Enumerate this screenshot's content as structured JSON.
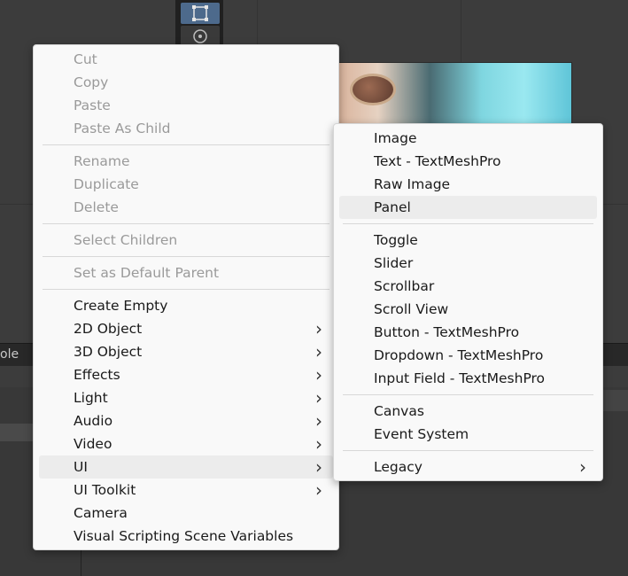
{
  "background": {
    "panel_tab_label": "ole"
  },
  "context_menu": {
    "groups": [
      [
        {
          "label": "Cut",
          "enabled": false
        },
        {
          "label": "Copy",
          "enabled": false
        },
        {
          "label": "Paste",
          "enabled": false
        },
        {
          "label": "Paste As Child",
          "enabled": false
        }
      ],
      [
        {
          "label": "Rename",
          "enabled": false
        },
        {
          "label": "Duplicate",
          "enabled": false
        },
        {
          "label": "Delete",
          "enabled": false
        }
      ],
      [
        {
          "label": "Select Children",
          "enabled": false
        }
      ],
      [
        {
          "label": "Set as Default Parent",
          "enabled": false
        }
      ],
      [
        {
          "label": "Create Empty",
          "enabled": true
        },
        {
          "label": "2D Object",
          "enabled": true,
          "submenu": true
        },
        {
          "label": "3D Object",
          "enabled": true,
          "submenu": true
        },
        {
          "label": "Effects",
          "enabled": true,
          "submenu": true
        },
        {
          "label": "Light",
          "enabled": true,
          "submenu": true
        },
        {
          "label": "Audio",
          "enabled": true,
          "submenu": true
        },
        {
          "label": "Video",
          "enabled": true,
          "submenu": true
        },
        {
          "label": "UI",
          "enabled": true,
          "submenu": true,
          "highlighted": true
        },
        {
          "label": "UI Toolkit",
          "enabled": true,
          "submenu": true
        },
        {
          "label": "Camera",
          "enabled": true
        },
        {
          "label": "Visual Scripting Scene Variables",
          "enabled": true
        }
      ]
    ]
  },
  "ui_submenu": {
    "groups": [
      [
        {
          "label": "Image"
        },
        {
          "label": "Text - TextMeshPro"
        },
        {
          "label": "Raw Image"
        },
        {
          "label": "Panel",
          "highlighted": true
        }
      ],
      [
        {
          "label": "Toggle"
        },
        {
          "label": "Slider"
        },
        {
          "label": "Scrollbar"
        },
        {
          "label": "Scroll View"
        },
        {
          "label": "Button - TextMeshPro"
        },
        {
          "label": "Dropdown - TextMeshPro"
        },
        {
          "label": "Input Field - TextMeshPro"
        }
      ],
      [
        {
          "label": "Canvas"
        },
        {
          "label": "Event System"
        }
      ],
      [
        {
          "label": "Legacy",
          "submenu": true
        }
      ]
    ]
  },
  "icons": {
    "submenu_arrow": "chevron-right-icon",
    "rect_tool": "rect-transform-tool-icon",
    "transform_tool": "transform-tool-icon"
  },
  "colors": {
    "menu_bg": "#f9f9f9",
    "highlight": "#ececec",
    "disabled_text": "#9a9a9a",
    "active_tool": "#4d6a8c"
  }
}
